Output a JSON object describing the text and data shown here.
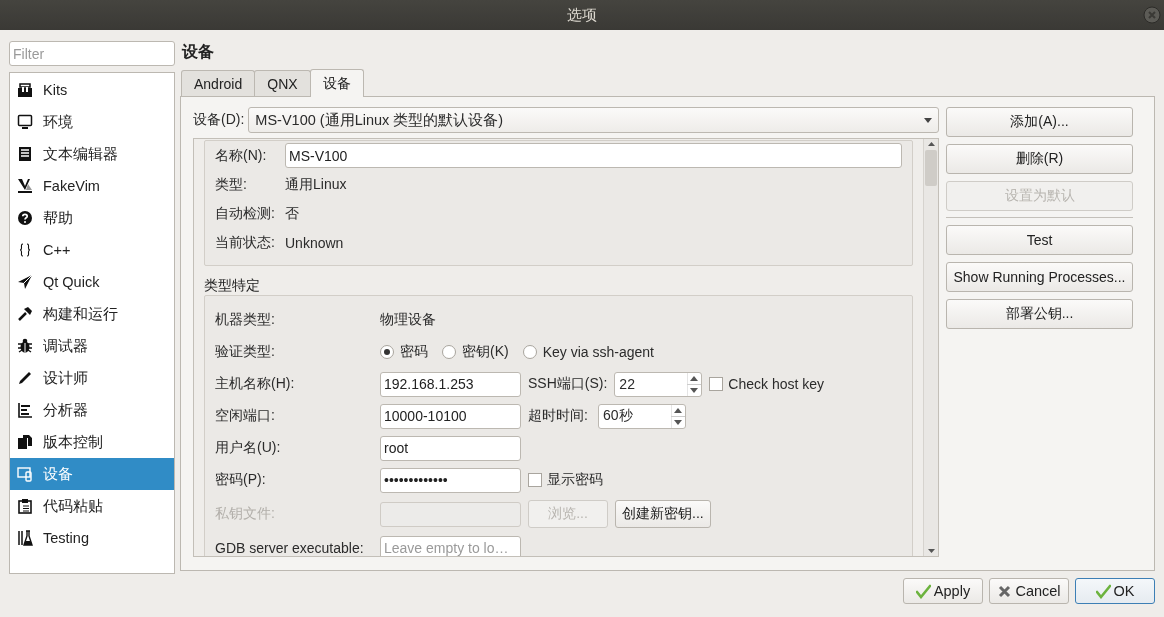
{
  "window": {
    "title": "选项"
  },
  "sidebar": {
    "filter": {
      "placeholder": "Filter"
    },
    "items": [
      {
        "label": "Kits",
        "selected": false
      },
      {
        "label": "环境",
        "selected": false
      },
      {
        "label": "文本编辑器",
        "selected": false
      },
      {
        "label": "FakeVim",
        "selected": false
      },
      {
        "label": "帮助",
        "selected": false
      },
      {
        "label": "C++",
        "selected": false
      },
      {
        "label": "Qt Quick",
        "selected": false
      },
      {
        "label": "构建和运行",
        "selected": false
      },
      {
        "label": "调试器",
        "selected": false
      },
      {
        "label": "设计师",
        "selected": false
      },
      {
        "label": "分析器",
        "selected": false
      },
      {
        "label": "版本控制",
        "selected": false
      },
      {
        "label": "设备",
        "selected": true
      },
      {
        "label": "代码粘贴",
        "selected": false
      },
      {
        "label": "Testing",
        "selected": false
      }
    ]
  },
  "page": {
    "title": "设备",
    "tabs": [
      {
        "label": "Android",
        "selected": false
      },
      {
        "label": "QNX",
        "selected": false
      },
      {
        "label": "设备",
        "selected": true
      }
    ],
    "device_selector": {
      "label": "设备(D):",
      "value": "MS-V100 (通用Linux 类型的默认设备)"
    },
    "general": [
      {
        "kind": "input",
        "label": "名称(N):",
        "value": "MS-V100"
      },
      {
        "kind": "text",
        "label": "类型:",
        "value": "通用Linux"
      },
      {
        "kind": "text",
        "label": "自动检测:",
        "value": "否"
      },
      {
        "kind": "text",
        "label": "当前状态:",
        "value": "Unknown"
      }
    ],
    "type_specific": {
      "title": "类型特定",
      "rows": [
        {
          "label": "机器类型:",
          "disabled": false,
          "controls": [
            {
              "kind": "text",
              "value": "物理设备"
            }
          ]
        },
        {
          "label": "验证类型:",
          "disabled": false,
          "controls": [
            {
              "kind": "radio",
              "label": "密码",
              "selected": true
            },
            {
              "kind": "radio",
              "label": "密钥(K)",
              "selected": false
            },
            {
              "kind": "radio",
              "label": "Key via ssh-agent",
              "selected": false
            }
          ]
        },
        {
          "label": "主机名称(H):",
          "disabled": false,
          "controls": [
            {
              "kind": "input",
              "value": "192.168.1.253",
              "disabled": false
            },
            {
              "kind": "label",
              "text": "SSH端口(S):"
            },
            {
              "kind": "spin",
              "value": "22"
            },
            {
              "kind": "checkbox",
              "label": "Check host key",
              "checked": false
            }
          ]
        },
        {
          "label": "空闲端口:",
          "disabled": false,
          "controls": [
            {
              "kind": "input",
              "value": "10000-10100",
              "disabled": false
            },
            {
              "kind": "label",
              "text": "超时时间:"
            },
            {
              "kind": "spin",
              "value": "60秒"
            }
          ]
        },
        {
          "label": "用户名(U):",
          "disabled": false,
          "controls": [
            {
              "kind": "input",
              "value": "root",
              "disabled": false
            }
          ]
        },
        {
          "label": "密码(P):",
          "disabled": false,
          "controls": [
            {
              "kind": "input",
              "value": "•••••••••••••",
              "disabled": false
            },
            {
              "kind": "checkbox",
              "label": "显示密码",
              "checked": false
            }
          ]
        },
        {
          "label": "私钥文件:",
          "disabled": true,
          "controls": [
            {
              "kind": "input",
              "disabled": true
            },
            {
              "kind": "button",
              "label": "浏览...",
              "disabled": true
            },
            {
              "kind": "button",
              "label": "创建新密钥...",
              "disabled": false
            }
          ]
        },
        {
          "label": "GDB server executable:",
          "disabled": false,
          "controls": [
            {
              "kind": "input",
              "placeholder": "Leave empty to lo…",
              "disabled": false
            }
          ]
        }
      ]
    }
  },
  "device_actions": [
    {
      "label": "添加(A)...",
      "disabled": false
    },
    {
      "label": "删除(R)",
      "disabled": false
    },
    {
      "label": "设置为默认",
      "disabled": true
    }
  ],
  "tool_actions": [
    {
      "label": "Test",
      "disabled": false
    },
    {
      "label": "Show Running Processes...",
      "disabled": false
    },
    {
      "label": "部署公钥...",
      "disabled": false
    }
  ],
  "footer": {
    "buttons": [
      {
        "label": "Apply",
        "kind": "apply",
        "default": false
      },
      {
        "label": "Cancel",
        "kind": "cancel",
        "default": false
      },
      {
        "label": "OK",
        "kind": "ok",
        "default": true
      }
    ]
  }
}
